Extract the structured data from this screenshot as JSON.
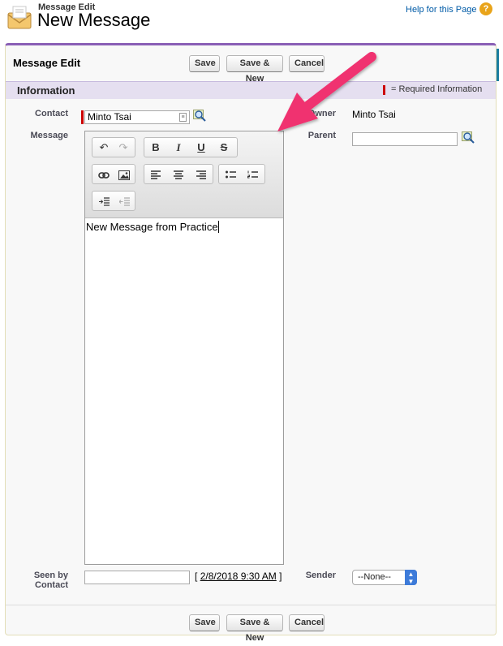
{
  "header": {
    "subtitle": "Message Edit",
    "title": "New Message",
    "help_link": "Help for this Page",
    "help_icon_glyph": "?"
  },
  "block": {
    "title": "Message Edit",
    "buttons": {
      "save": "Save",
      "save_new": "Save & New",
      "cancel": "Cancel"
    }
  },
  "section": {
    "title": "Information",
    "required_legend": "= Required Information"
  },
  "fields": {
    "contact_label": "Contact",
    "contact_value": "Minto Tsai",
    "message_label": "Message",
    "message_body": "New Message from Practice",
    "owner_label": "Owner",
    "owner_value": "Minto Tsai",
    "parent_label": "Parent",
    "parent_value": "",
    "seen_by_contact_label": "Seen by Contact",
    "seen_by_contact_value": "",
    "seen_date_link": "2/8/2018 9:30 AM",
    "bracket_open": "[",
    "bracket_close": "]",
    "sender_label": "Sender",
    "sender_selected": "--None--"
  },
  "toolbar": {
    "icons": [
      "undo-icon",
      "redo-icon",
      "bold-icon",
      "italic-icon",
      "underline-icon",
      "strikethrough-icon",
      "link-icon",
      "image-icon",
      "align-left-icon",
      "align-center-icon",
      "align-right-icon",
      "bulleted-list-icon",
      "numbered-list-icon",
      "indent-icon",
      "outdent-icon"
    ],
    "bold_glyph": "B",
    "italic_glyph": "I",
    "underline_glyph": "U",
    "strike_glyph": "S"
  },
  "colors": {
    "accent_purple": "#8a5fb5",
    "section_bg": "#e5dff0",
    "required_red": "#cc0000",
    "link_blue": "#015ba7",
    "annotation_arrow": "#f0316f",
    "select_blue": "#3d7bd9"
  }
}
